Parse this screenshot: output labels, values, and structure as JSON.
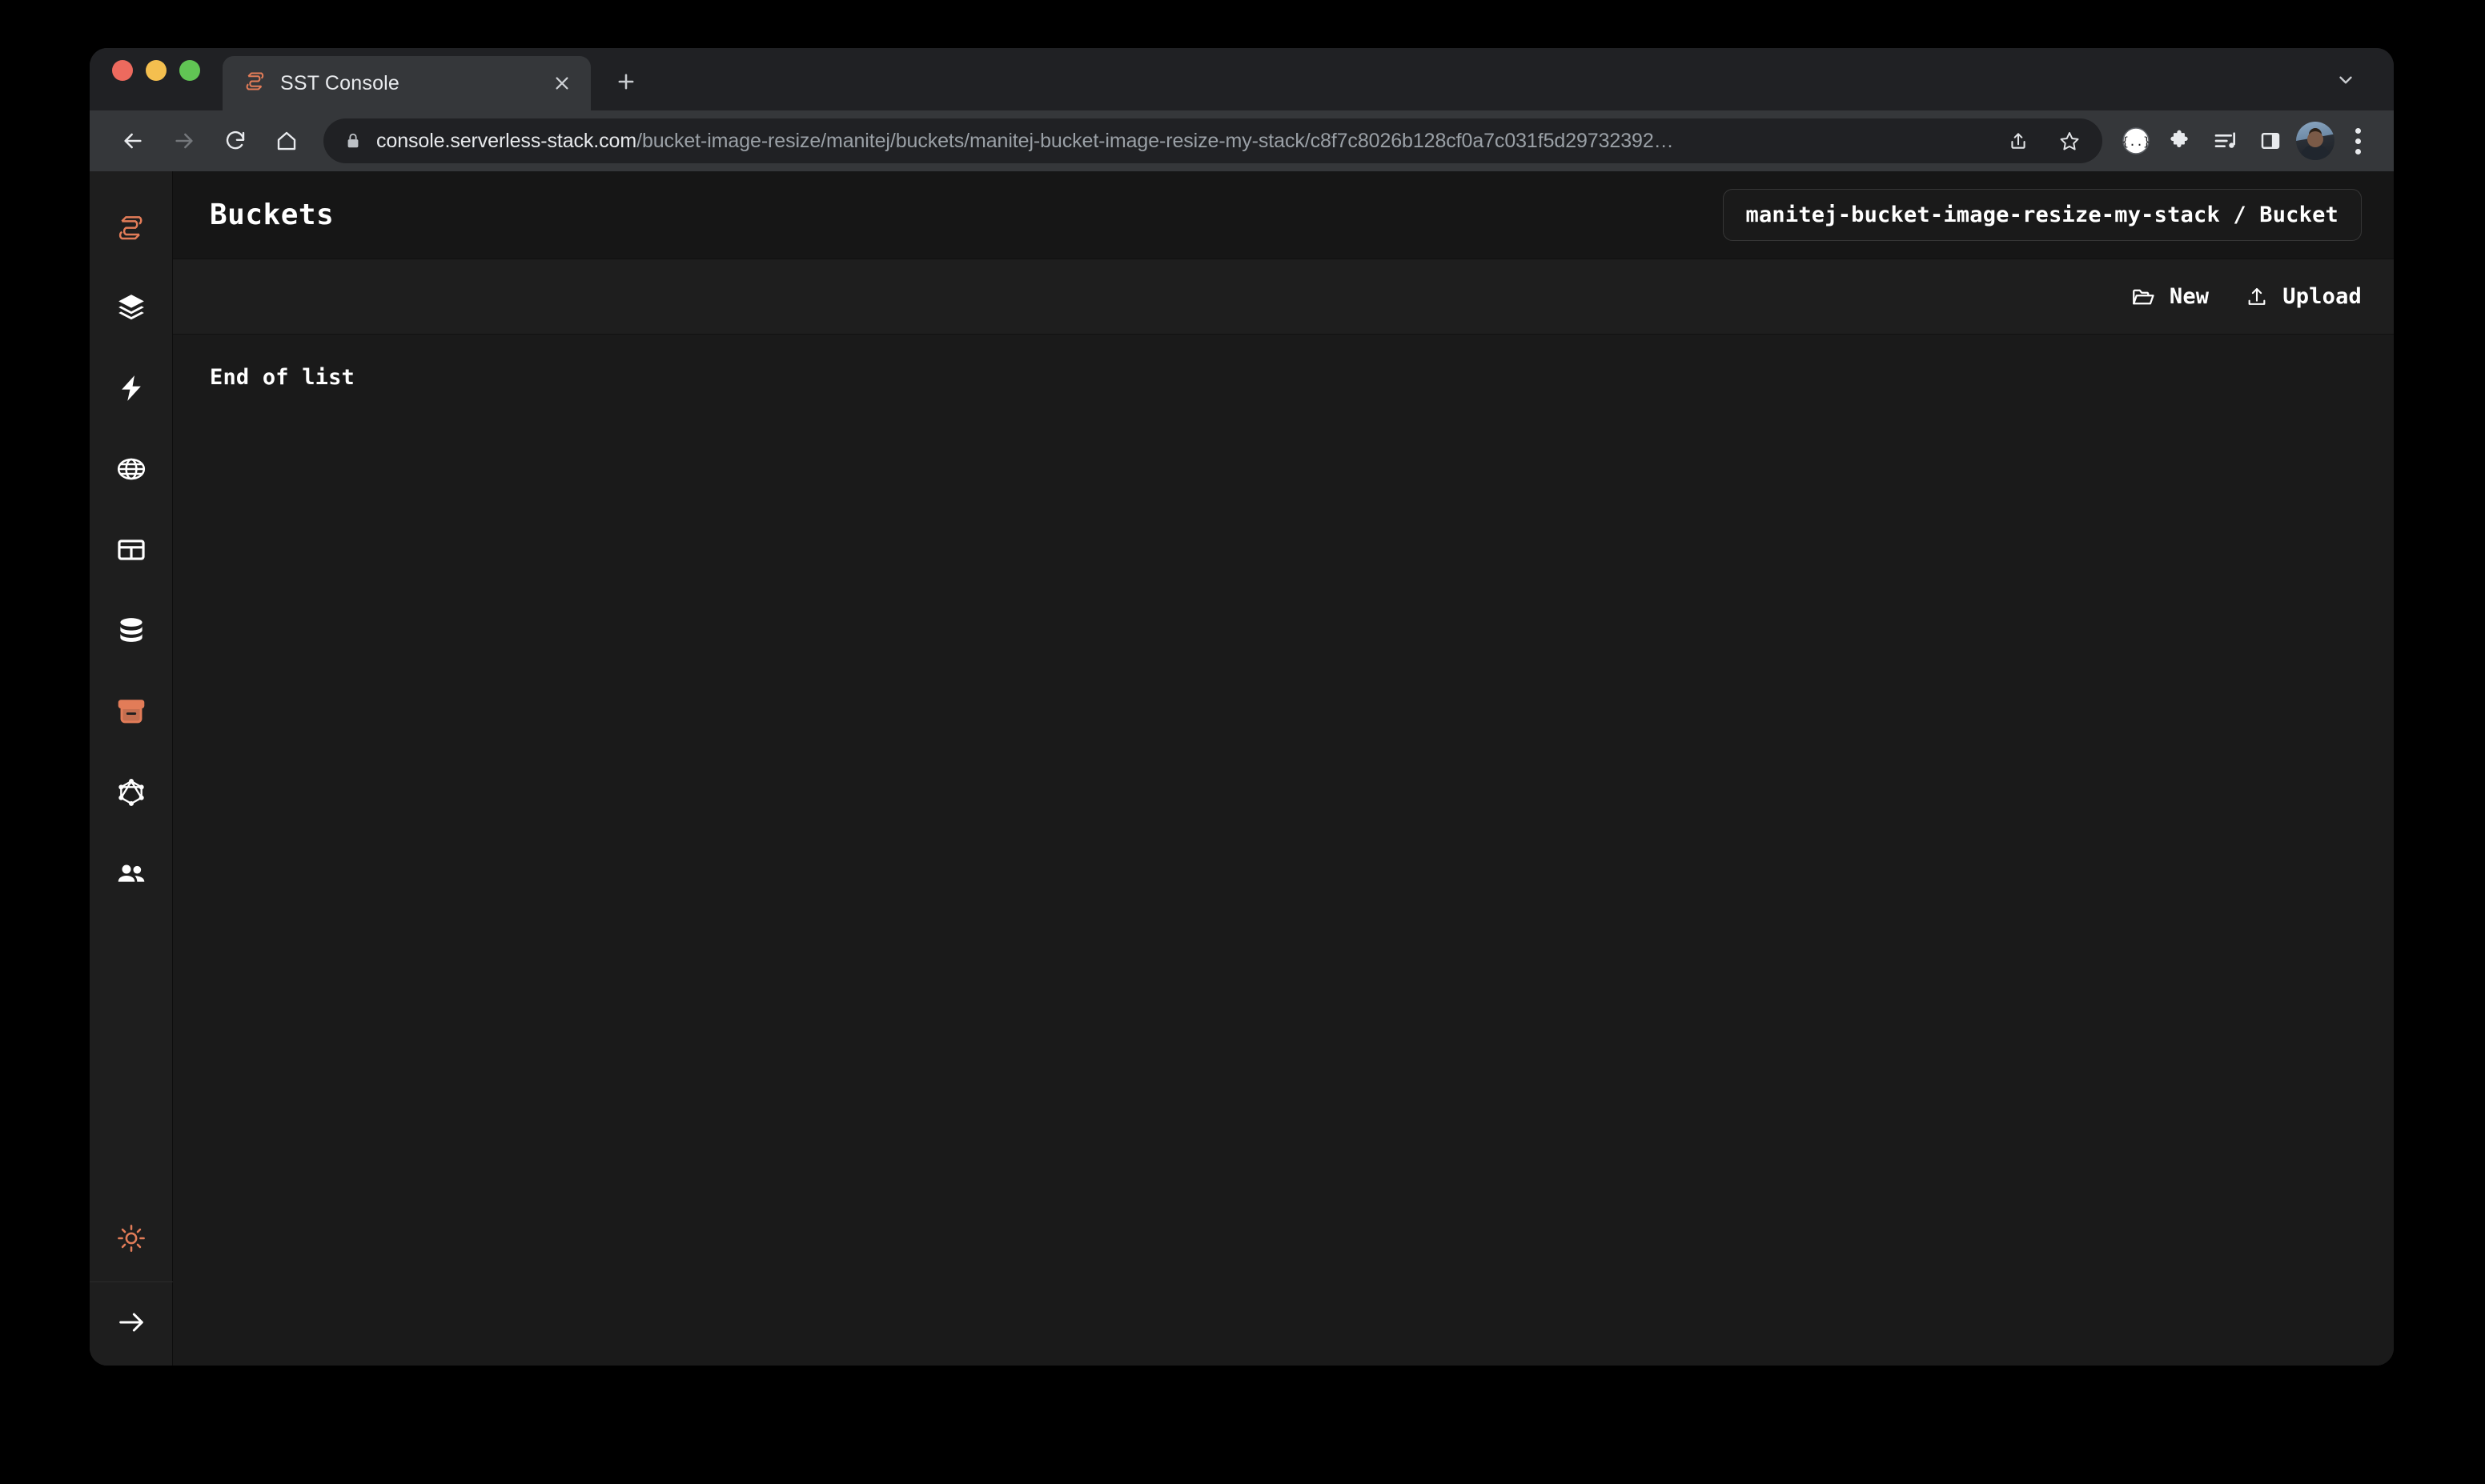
{
  "browser": {
    "traffic_lights": [
      "close",
      "minimize",
      "zoom"
    ],
    "tabs": [
      {
        "title": "SST Console",
        "favicon": "sst-logo-icon",
        "active": true
      }
    ],
    "new_tab_label": "+",
    "tab_search_icon": "chevron-down-icon",
    "nav": {
      "back": "back-arrow-icon",
      "forward": "forward-arrow-icon",
      "reload": "reload-icon",
      "home": "home-icon"
    },
    "omnibox": {
      "lock_icon": "lock-icon",
      "url_host": "console.serverless-stack.com",
      "url_path": "/bucket-image-resize/manitej/buckets/manitej-bucket-image-resize-my-stack/c8f7c8026b128cf0a7c031f5d29732392…",
      "share_icon": "share-icon",
      "bookmark_icon": "star-icon"
    },
    "extensions": [
      {
        "name": "json-viewer-icon",
        "label": "{…}"
      },
      {
        "name": "extensions-puzzle-icon",
        "label": ""
      },
      {
        "name": "media-playlist-icon",
        "label": ""
      },
      {
        "name": "side-panel-icon",
        "label": ""
      }
    ],
    "profile": {
      "name": "avatar"
    },
    "menu_icon": "three-dot-menu-icon"
  },
  "app": {
    "sidebar": {
      "items": [
        {
          "name": "logo",
          "icon": "sst-logo-icon",
          "active": false
        },
        {
          "name": "stacks",
          "icon": "layers-icon",
          "active": false
        },
        {
          "name": "functions",
          "icon": "lightning-icon",
          "active": false
        },
        {
          "name": "api",
          "icon": "globe-icon",
          "active": false
        },
        {
          "name": "rds",
          "icon": "table-icon",
          "active": false
        },
        {
          "name": "dynamodb",
          "icon": "database-icon",
          "active": false
        },
        {
          "name": "buckets",
          "icon": "bucket-icon",
          "active": true
        },
        {
          "name": "graphql",
          "icon": "graphql-icon",
          "active": false
        },
        {
          "name": "cognito",
          "icon": "users-icon",
          "active": false
        }
      ],
      "bottom": [
        {
          "name": "theme-toggle",
          "icon": "sun-icon",
          "active": true
        },
        {
          "name": "expand-sidebar",
          "icon": "arrow-right-icon",
          "active": false
        }
      ]
    },
    "header": {
      "title": "Buckets",
      "scope": "manitej-bucket-image-resize-my-stack / Bucket"
    },
    "toolbar": {
      "new_label": "New",
      "new_icon": "folder-open-icon",
      "upload_label": "Upload",
      "upload_icon": "upload-icon"
    },
    "list": {
      "end_of_list_label": "End of list",
      "items": []
    }
  },
  "colors": {
    "accent": "#e27c58",
    "page_bg": "#1a1a1a",
    "sidebar_bg": "#1e1e1e",
    "header_bg": "#161616",
    "toolbar_bg": "#1e1e1e",
    "text": "#ffffff",
    "browser_chrome": "#35373a",
    "browser_tabstrip": "#202124",
    "omnibox_bg": "#202124"
  }
}
